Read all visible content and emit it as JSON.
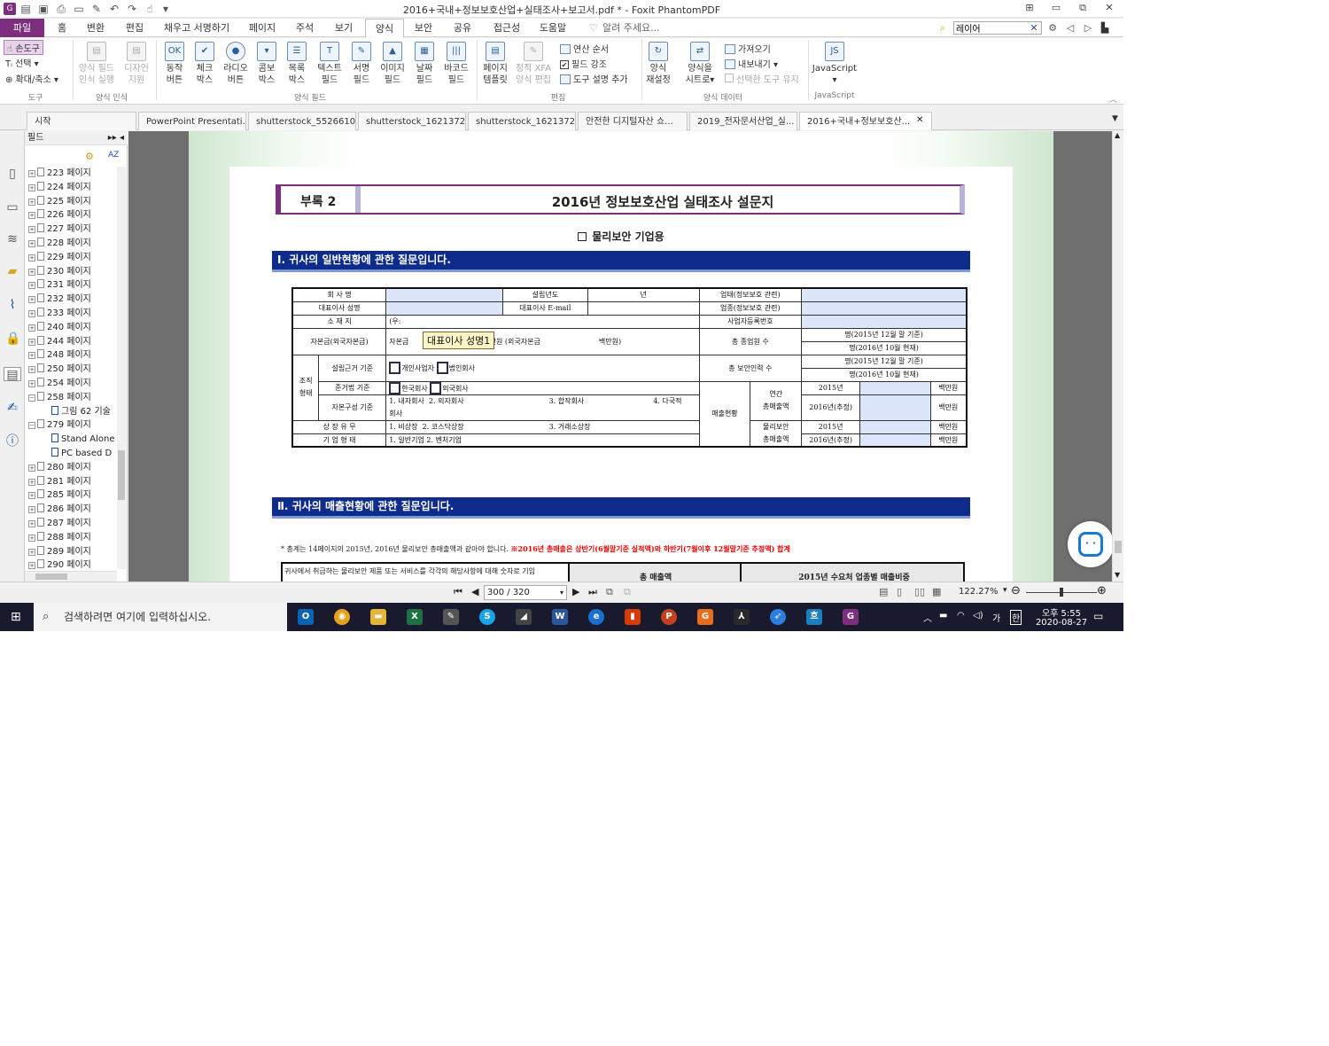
{
  "window": {
    "title": "2016+국내+정보보호산업+실태조사+보고서.pdf * - Foxit PhantomPDF"
  },
  "menu": {
    "tabs": [
      "파일",
      "홈",
      "변환",
      "편집",
      "채우고 서명하기",
      "페이지",
      "주석",
      "보기",
      "양식",
      "보안",
      "공유",
      "접근성",
      "도움말"
    ],
    "tell_me": "알려 주세요...",
    "search_value": "레이어"
  },
  "ribbon": {
    "tools": {
      "hand": "손도구",
      "select": "선택",
      "zoom": "확대/축소",
      "group": "도구"
    },
    "recognition": {
      "b1a": "양식 필드",
      "b1b": "인식 실행",
      "b2a": "디자인",
      "b2b": "지원",
      "group": "양식 인식"
    },
    "fields": {
      "push": [
        "동작",
        "버튼"
      ],
      "check": [
        "체크",
        "박스"
      ],
      "radio": [
        "라디오",
        "버튼"
      ],
      "combo": [
        "콤보",
        "박스"
      ],
      "list": [
        "목록",
        "박스"
      ],
      "text": [
        "텍스트",
        "필드"
      ],
      "sign": [
        "서명",
        "필드"
      ],
      "image": [
        "이미지",
        "필드"
      ],
      "date": [
        "날짜",
        "필드"
      ],
      "barcode": [
        "바코드",
        "필드"
      ],
      "group": "양식 필드"
    },
    "edit": {
      "template": [
        "페이지",
        "템플릿"
      ],
      "xfa": [
        "정적 XFA",
        "양식 편집"
      ],
      "calc": "연산 순서",
      "highlight": "필드 강조",
      "tooltip": "도구 설명 추가",
      "group": "편집"
    },
    "data": {
      "reset": [
        "양식",
        "재설정"
      ],
      "sheet": [
        "양식을",
        "시트로"
      ],
      "import": "가져오기",
      "export": "내보내기",
      "keep": "선택한 도구 유지",
      "group": "양식 데이터"
    },
    "js": {
      "label": "JavaScript",
      "group": "JavaScript"
    }
  },
  "doc_tabs": [
    "시작",
    "PowerPoint Presentati...",
    "shutterstock_55266105...",
    "shutterstock_16213728...",
    "shutterstock_16213728...",
    "안전한 디지털자산 쇼...",
    "2019_전자문서산업_실...",
    "2016+국내+정보보호산..."
  ],
  "field_panel": {
    "title": "필드",
    "items": [
      "223 페이지",
      "224 페이지",
      "225 페이지",
      "226 페이지",
      "227 페이지",
      "228 페이지",
      "229 페이지",
      "230 페이지",
      "231 페이지",
      "232 페이지",
      "233 페이지",
      "240 페이지",
      "244 페이지",
      "248 페이지",
      "250 페이지",
      "254 페이지",
      "258 페이지",
      "그림 62 기술",
      "279 페이지",
      "Stand Alone",
      "PC based D",
      "280 페이지",
      "281 페이지",
      "285 페이지",
      "286 페이지",
      "287 페이지",
      "288 페이지",
      "289 페이지",
      "290 페이지"
    ]
  },
  "document": {
    "appendix": "부록 2",
    "title": "2016년 정보보호산업 실태조사 설문지",
    "subtitle": "물리보안 기업용",
    "section1": "Ⅰ. 귀사의 일반현황에 관한 질문입니다.",
    "section2": "Ⅱ. 귀사의 매출현황에 관한 질문입니다.",
    "tooltip": "대표이사 성명1",
    "note_black": "* 총계는 14페이지의 2015년, 2016년 물리보안 총매출액과 같아야 합니다.",
    "note_red": "※2016년 총매출은 상반기(6월말기준 실적액)와 하반기(7월이후 12월말기준 추정액) 합계",
    "table": {
      "company": "회 사 명",
      "founded": "설립년도",
      "year_unit": "년",
      "industry": "업태(정보보호 관련)",
      "ceo": "대표이사 성명",
      "ceo_email": "대표이사 E-mail",
      "sector": "업종(정보보호 관련)",
      "address": "소 재 지",
      "zip": "(우:",
      "reg_no": "사업자등록번호",
      "capital": "자본금(외국자본금)",
      "capital_val": "자본금",
      "foreign": "백만원 (외국자본금",
      "million": "백만원)",
      "employees": "총 종업원 수",
      "emp2015": "명(2015년 12월 말 기준)",
      "emp2016": "명(2016년 10월 현재)",
      "security_staff": "총 보안인력 수",
      "org": "조직\n형태",
      "basis": "설립근거 기준",
      "basis_opts": [
        "개인사업자",
        "법인회사"
      ],
      "law": "준거법 기준",
      "law_opts": [
        "한국회사",
        "외국회사"
      ],
      "capital_comp": "자본구성 기준",
      "cap_opts": [
        "1. 내자회사",
        "2. 외자회사",
        "3. 합작회사",
        "4. 다국적"
      ],
      "company_word": "회사",
      "listed": "상 장 유 무",
      "listed_opts": [
        "1. 비상장",
        "2. 코스닥상장",
        "3. 거래소상장"
      ],
      "type": "기 업 형 태",
      "type_opts": [
        "1. 일반기업",
        "2. 벤처기업"
      ],
      "sales": "매출현황",
      "annual": "연간\n총매출액",
      "physical": "물리보안\n총매출액",
      "y2015": "2015년",
      "y2016": "2016년(추정)",
      "unit": "백만원"
    },
    "table2": {
      "c1": "귀사에서 취급하는 물리보안 제품 또는 서비스를 각각의 해당사항에 대해 숫자로 기입",
      "c2": "총 매출액",
      "c3": "2015년 수요처 업종별 매출비중"
    }
  },
  "status": {
    "page": "300 / 320",
    "zoom": "122.27%"
  },
  "taskbar": {
    "search": "검색하려면 여기에 입력하십시오.",
    "time": "오후 5:55",
    "date": "2020-08-27",
    "lang": "가"
  }
}
